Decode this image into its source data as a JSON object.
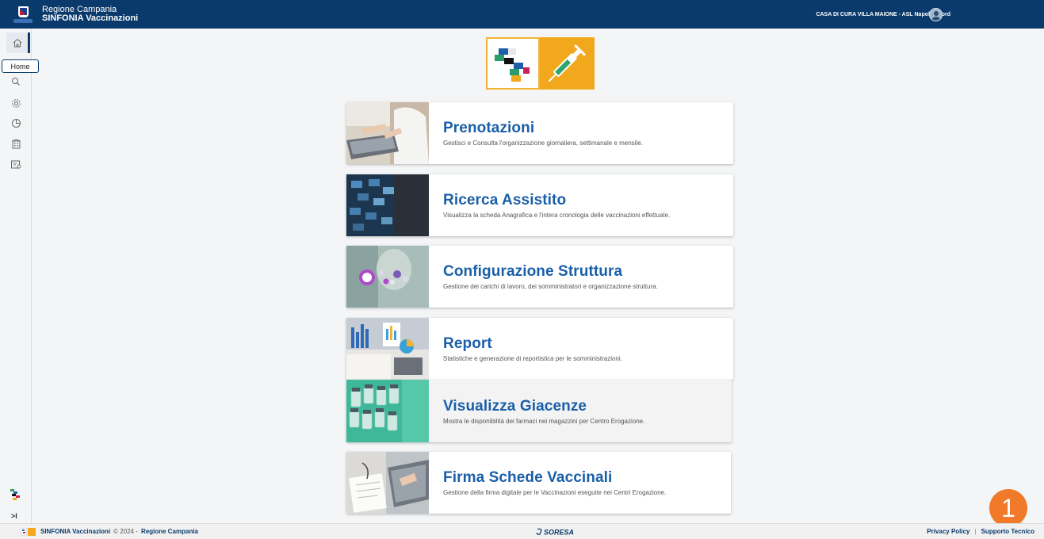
{
  "header": {
    "region": "Regione Campania",
    "app": "SINFONIA Vaccinazioni",
    "structure": "CASA DI CURA VILLA MAIONE - ASL Napoli 2 Nord"
  },
  "sidebar": {
    "tooltip": "Home",
    "items": [
      {
        "name": "home",
        "icon": "home-icon"
      },
      {
        "name": "search",
        "icon": "search-icon"
      },
      {
        "name": "settings",
        "icon": "gear-icon"
      },
      {
        "name": "reports",
        "icon": "pie-chart-icon"
      },
      {
        "name": "building",
        "icon": "building-icon"
      },
      {
        "name": "signature",
        "icon": "signed-document-icon"
      }
    ],
    "collapse": ">I"
  },
  "cards": [
    {
      "title": "Prenotazioni",
      "desc": "Gestisci e Consulta l'organizzazione giornaliera, settimanale e mensile."
    },
    {
      "title": "Ricerca Assistito",
      "desc": "Visualizza la scheda Anagrafica e l'intera cronologia delle vaccinazioni effettuate."
    },
    {
      "title": "Configurazione Struttura",
      "desc": "Gestione dei carichi di lavoro, dei somministratori e organizzazione struttura."
    },
    {
      "title": "Report",
      "desc": "Statistiche e generazione di reportistica per le somministrazioni."
    },
    {
      "title": "Visualizza Giacenze",
      "desc": "Mostra le disponibilità dei farmaci nei magazzini per Centro Erogazione."
    },
    {
      "title": "Firma Schede Vaccinali",
      "desc": "Gestione della firma digitale per le Vaccinazioni eseguite nei Centri Erogazione."
    }
  ],
  "footer": {
    "app": "SINFONIA Vaccinazioni",
    "copyright": "© 2024 -",
    "region": "Regione Campania",
    "partner": "SORESA",
    "privacy": "Privacy Policy",
    "separator": "|",
    "support": "Supporto Tecnico"
  },
  "badge": "1",
  "colors": {
    "header": "#0a3a6b",
    "title": "#1a5fa8",
    "badge": "#f07a2a",
    "logo_orange": "#f2a81d"
  }
}
